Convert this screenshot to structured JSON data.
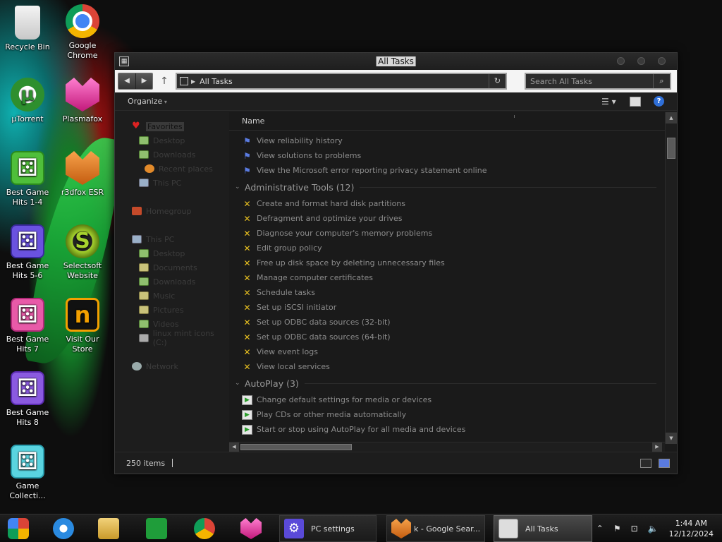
{
  "desktop": {
    "icons": [
      {
        "label": "Recycle Bin",
        "icon": "recycle-bin-icon"
      },
      {
        "label": "Google Chrome",
        "icon": "chrome-icon"
      },
      {
        "label": "µTorrent",
        "icon": "utorrent-icon"
      },
      {
        "label": "Plasmafox",
        "icon": "plasmafox-icon"
      },
      {
        "label": "Best Game Hits 1-4",
        "icon": "dice-green-icon"
      },
      {
        "label": "r3dfox ESR",
        "icon": "r3dfox-icon"
      },
      {
        "label": "Best Game Hits 5-6",
        "icon": "dice-purple-icon"
      },
      {
        "label": "Selectsoft Website",
        "icon": "selectsoft-icon"
      },
      {
        "label": "Best Game Hits 7",
        "icon": "dice-pink-icon"
      },
      {
        "label": "Visit Our Store",
        "icon": "store-icon"
      },
      {
        "label": "Best Game Hits 8",
        "icon": "dice-violet-icon"
      },
      {
        "label": "Game Collecti...",
        "icon": "dice-cyan-icon"
      }
    ]
  },
  "window": {
    "title": "All Tasks",
    "address": "All Tasks",
    "search_placeholder": "Search All Tasks",
    "organize_label": "Organize",
    "column_name": "Name",
    "status_count": "250 items"
  },
  "nav_pane": {
    "favorites": "Favorites",
    "fav_items": [
      "Desktop",
      "Downloads",
      "Recent places",
      "This PC"
    ],
    "homegroup": "Homegroup",
    "this_pc": "This PC",
    "pc_items": [
      "Desktop",
      "Documents",
      "Downloads",
      "Music",
      "Pictures",
      "Videos",
      "linux mint icons (C:)"
    ],
    "network": "Network"
  },
  "list": {
    "top_items": [
      "View reliability history",
      "View solutions to problems",
      "View the Microsoft error reporting privacy statement online"
    ],
    "admin_header": "Administrative Tools (12)",
    "admin_items": [
      "Create and format hard disk partitions",
      "Defragment and optimize your drives",
      "Diagnose your computer's memory problems",
      "Edit group policy",
      "Free up disk space by deleting unnecessary files",
      "Manage computer certificates",
      "Schedule tasks",
      "Set up iSCSI initiator",
      "Set up ODBC data sources (32-bit)",
      "Set up ODBC data sources (64-bit)",
      "View event logs",
      "View local services"
    ],
    "autoplay_header": "AutoPlay (3)",
    "autoplay_items": [
      "Change default settings for media or devices",
      "Play CDs or other media automatically",
      "Start or stop using AutoPlay for all media and devices"
    ]
  },
  "taskbar": {
    "tasks": [
      {
        "label": "PC settings",
        "icon": "gear-icon"
      },
      {
        "label": "k - Google Sear...",
        "icon": "r3dfox-icon"
      },
      {
        "label": "All Tasks",
        "icon": "explorer-icon"
      }
    ],
    "clock_time": "1:44 AM",
    "clock_date": "12/12/2024"
  },
  "colors": {
    "accent": "#5a7be0",
    "window_bg": "#1d1d1d",
    "text_dim": "#8c8c8c"
  }
}
